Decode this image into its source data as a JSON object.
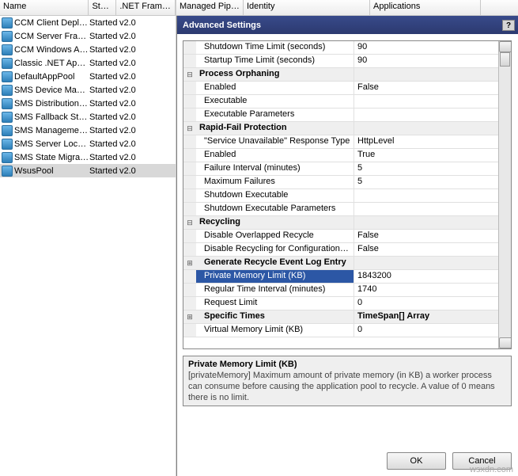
{
  "list": {
    "cols": {
      "name": "Name",
      "status": "Status",
      "framework": ".NET Frame…",
      "pipeline": "Managed Pipeli…",
      "identity": "Identity",
      "applications": "Applications"
    },
    "rows": [
      {
        "name": "CCM Client Deplo…",
        "status": "Started",
        "framework": "v2.0"
      },
      {
        "name": "CCM Server Fram…",
        "status": "Started",
        "framework": "v2.0"
      },
      {
        "name": "CCM Windows Au…",
        "status": "Started",
        "framework": "v2.0"
      },
      {
        "name": "Classic .NET App…",
        "status": "Started",
        "framework": "v2.0"
      },
      {
        "name": "DefaultAppPool",
        "status": "Started",
        "framework": "v2.0"
      },
      {
        "name": "SMS Device Mana…",
        "status": "Started",
        "framework": "v2.0"
      },
      {
        "name": "SMS Distribution …",
        "status": "Started",
        "framework": "v2.0"
      },
      {
        "name": "SMS Fallback Stat…",
        "status": "Started",
        "framework": "v2.0"
      },
      {
        "name": "SMS Managemen…",
        "status": "Started",
        "framework": "v2.0"
      },
      {
        "name": "SMS Server Locat…",
        "status": "Started",
        "framework": "v2.0"
      },
      {
        "name": "SMS State Migrati…",
        "status": "Started",
        "framework": "v2.0"
      },
      {
        "name": "WsusPool",
        "status": "Started",
        "framework": "v2.0"
      }
    ],
    "selected_index": 11
  },
  "dialog": {
    "title": "Advanced Settings",
    "help_button": "?",
    "ok": "OK",
    "cancel": "Cancel"
  },
  "grid": {
    "r0": {
      "key": "Shutdown Time Limit (seconds)",
      "val": "90"
    },
    "r1": {
      "key": "Startup Time Limit (seconds)",
      "val": "90"
    },
    "c0": "Process Orphaning",
    "r2": {
      "key": "Enabled",
      "val": "False"
    },
    "r3": {
      "key": "Executable",
      "val": ""
    },
    "r4": {
      "key": "Executable Parameters",
      "val": ""
    },
    "c1": "Rapid-Fail Protection",
    "r5": {
      "key": "\"Service Unavailable\" Response Type",
      "val": "HttpLevel"
    },
    "r6": {
      "key": "Enabled",
      "val": "True"
    },
    "r7": {
      "key": "Failure Interval (minutes)",
      "val": "5"
    },
    "r8": {
      "key": "Maximum Failures",
      "val": "5"
    },
    "r9": {
      "key": "Shutdown Executable",
      "val": ""
    },
    "r10": {
      "key": "Shutdown Executable Parameters",
      "val": ""
    },
    "c2": "Recycling",
    "r11": {
      "key": "Disable Overlapped Recycle",
      "val": "False"
    },
    "r12": {
      "key": "Disable Recycling for Configuration Ch",
      "val": "False"
    },
    "c3": "Generate Recycle Event Log Entry",
    "r13": {
      "key": "Private Memory Limit (KB)",
      "val": "1843200"
    },
    "r14": {
      "key": "Regular Time Interval (minutes)",
      "val": "1740"
    },
    "r15": {
      "key": "Request Limit",
      "val": "0"
    },
    "c4": {
      "key": "Specific Times",
      "val": "TimeSpan[] Array"
    },
    "r16": {
      "key": "Virtual Memory Limit (KB)",
      "val": "0"
    }
  },
  "help": {
    "title": "Private Memory Limit (KB)",
    "body": "[privateMemory] Maximum amount of private memory (in KB) a worker process can consume before causing the application pool to recycle.  A value of 0 means there is no limit."
  },
  "glyph": {
    "plus": "⊞",
    "minus": "⊟",
    "up": "▲",
    "down": "▼"
  },
  "watermark": "wsxdn.com"
}
